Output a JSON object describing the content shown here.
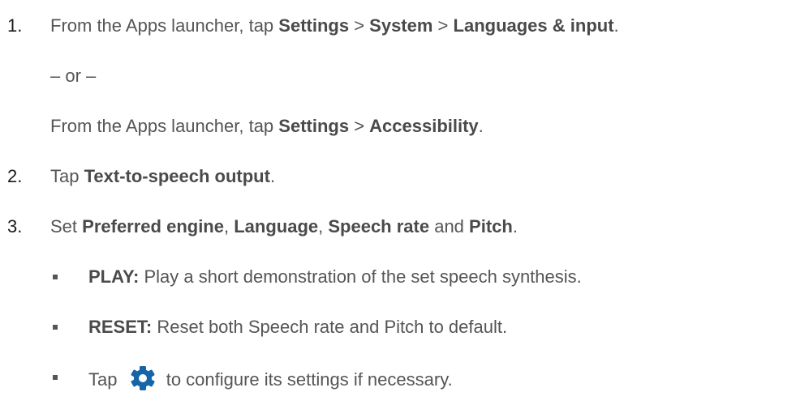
{
  "steps": [
    {
      "number": "1.",
      "prefix": "From the Apps launcher, tap ",
      "settings": "Settings",
      "sep1": " > ",
      "system": "System",
      "sep2": " > ",
      "languages": "Languages & input",
      "suffix": "."
    },
    {
      "number": "2.",
      "prefix": "Tap ",
      "target": "Text-to-speech output",
      "suffix": "."
    },
    {
      "number": "3.",
      "prefix": "Set ",
      "engine": "Preferred engine",
      "sep1": ", ",
      "language": "Language",
      "sep2": ", ",
      "rate": "Speech rate",
      "and": " and ",
      "pitch": "Pitch",
      "suffix": "."
    }
  ],
  "alternative": {
    "or": "– or –",
    "prefix": "From the Apps launcher, tap ",
    "settings": "Settings",
    "sep": " > ",
    "accessibility": "Accessibility",
    "suffix": "."
  },
  "bullets": [
    {
      "label": "PLAY:",
      "text": " Play a short demonstration of the set speech synthesis."
    },
    {
      "label": "RESET:",
      "text": " Reset both Speech rate and Pitch to default."
    },
    {
      "prefix": "Tap ",
      "icon": "gear-icon",
      "suffix": " to configure its settings if necessary."
    }
  ],
  "colors": {
    "text": "#555555",
    "number": "#1a1a1a",
    "gear_icon": "#1565a8"
  }
}
